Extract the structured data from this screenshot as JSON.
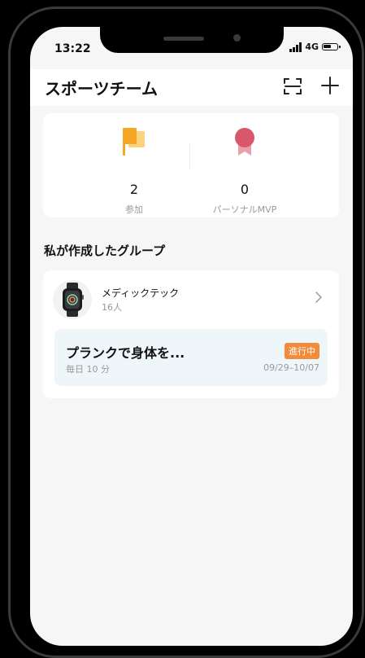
{
  "status_bar": {
    "time": "13:22",
    "network": "4G"
  },
  "header": {
    "title": "スポーツチーム",
    "scan_icon": "scan-icon",
    "add_icon": "plus-icon"
  },
  "stats": [
    {
      "value": "2",
      "label": "参加",
      "icon": "flag-icon",
      "color": "#f5a623"
    },
    {
      "value": "0",
      "label": "パーソナルMVP",
      "icon": "medal-icon",
      "color": "#d9576b"
    }
  ],
  "section_title": "私が作成したグループ",
  "group": {
    "name": "メディックテック",
    "member_count": "16人",
    "challenge": {
      "title": "プランクで身体を...",
      "frequency": "毎日 10 分",
      "status": "進行中",
      "dates": "09/29–10/07"
    }
  },
  "colors": {
    "accent_orange": "#f28b3c",
    "challenge_bg": "#eef6fa"
  }
}
